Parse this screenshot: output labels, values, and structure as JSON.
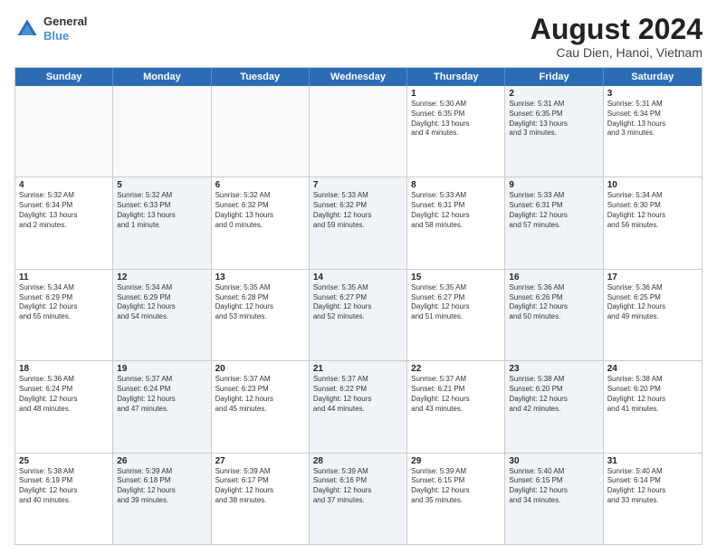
{
  "header": {
    "logo_general": "General",
    "logo_blue": "Blue",
    "title": "August 2024",
    "subtitle": "Cau Dien, Hanoi, Vietnam"
  },
  "weekdays": [
    "Sunday",
    "Monday",
    "Tuesday",
    "Wednesday",
    "Thursday",
    "Friday",
    "Saturday"
  ],
  "weeks": [
    [
      {
        "day": "",
        "info": "",
        "shaded": false,
        "empty": true
      },
      {
        "day": "",
        "info": "",
        "shaded": false,
        "empty": true
      },
      {
        "day": "",
        "info": "",
        "shaded": false,
        "empty": true
      },
      {
        "day": "",
        "info": "",
        "shaded": false,
        "empty": true
      },
      {
        "day": "1",
        "info": "Sunrise: 5:30 AM\nSunset: 6:35 PM\nDaylight: 13 hours\nand 4 minutes.",
        "shaded": false,
        "empty": false
      },
      {
        "day": "2",
        "info": "Sunrise: 5:31 AM\nSunset: 6:35 PM\nDaylight: 13 hours\nand 3 minutes.",
        "shaded": true,
        "empty": false
      },
      {
        "day": "3",
        "info": "Sunrise: 5:31 AM\nSunset: 6:34 PM\nDaylight: 13 hours\nand 3 minutes.",
        "shaded": false,
        "empty": false
      }
    ],
    [
      {
        "day": "4",
        "info": "Sunrise: 5:32 AM\nSunset: 6:34 PM\nDaylight: 13 hours\nand 2 minutes.",
        "shaded": false,
        "empty": false
      },
      {
        "day": "5",
        "info": "Sunrise: 5:32 AM\nSunset: 6:33 PM\nDaylight: 13 hours\nand 1 minute.",
        "shaded": true,
        "empty": false
      },
      {
        "day": "6",
        "info": "Sunrise: 5:32 AM\nSunset: 6:32 PM\nDaylight: 13 hours\nand 0 minutes.",
        "shaded": false,
        "empty": false
      },
      {
        "day": "7",
        "info": "Sunrise: 5:33 AM\nSunset: 6:32 PM\nDaylight: 12 hours\nand 59 minutes.",
        "shaded": true,
        "empty": false
      },
      {
        "day": "8",
        "info": "Sunrise: 5:33 AM\nSunset: 6:31 PM\nDaylight: 12 hours\nand 58 minutes.",
        "shaded": false,
        "empty": false
      },
      {
        "day": "9",
        "info": "Sunrise: 5:33 AM\nSunset: 6:31 PM\nDaylight: 12 hours\nand 57 minutes.",
        "shaded": true,
        "empty": false
      },
      {
        "day": "10",
        "info": "Sunrise: 5:34 AM\nSunset: 6:30 PM\nDaylight: 12 hours\nand 56 minutes.",
        "shaded": false,
        "empty": false
      }
    ],
    [
      {
        "day": "11",
        "info": "Sunrise: 5:34 AM\nSunset: 6:29 PM\nDaylight: 12 hours\nand 55 minutes.",
        "shaded": false,
        "empty": false
      },
      {
        "day": "12",
        "info": "Sunrise: 5:34 AM\nSunset: 6:29 PM\nDaylight: 12 hours\nand 54 minutes.",
        "shaded": true,
        "empty": false
      },
      {
        "day": "13",
        "info": "Sunrise: 5:35 AM\nSunset: 6:28 PM\nDaylight: 12 hours\nand 53 minutes.",
        "shaded": false,
        "empty": false
      },
      {
        "day": "14",
        "info": "Sunrise: 5:35 AM\nSunset: 6:27 PM\nDaylight: 12 hours\nand 52 minutes.",
        "shaded": true,
        "empty": false
      },
      {
        "day": "15",
        "info": "Sunrise: 5:35 AM\nSunset: 6:27 PM\nDaylight: 12 hours\nand 51 minutes.",
        "shaded": false,
        "empty": false
      },
      {
        "day": "16",
        "info": "Sunrise: 5:36 AM\nSunset: 6:26 PM\nDaylight: 12 hours\nand 50 minutes.",
        "shaded": true,
        "empty": false
      },
      {
        "day": "17",
        "info": "Sunrise: 5:36 AM\nSunset: 6:25 PM\nDaylight: 12 hours\nand 49 minutes.",
        "shaded": false,
        "empty": false
      }
    ],
    [
      {
        "day": "18",
        "info": "Sunrise: 5:36 AM\nSunset: 6:24 PM\nDaylight: 12 hours\nand 48 minutes.",
        "shaded": false,
        "empty": false
      },
      {
        "day": "19",
        "info": "Sunrise: 5:37 AM\nSunset: 6:24 PM\nDaylight: 12 hours\nand 47 minutes.",
        "shaded": true,
        "empty": false
      },
      {
        "day": "20",
        "info": "Sunrise: 5:37 AM\nSunset: 6:23 PM\nDaylight: 12 hours\nand 45 minutes.",
        "shaded": false,
        "empty": false
      },
      {
        "day": "21",
        "info": "Sunrise: 5:37 AM\nSunset: 6:22 PM\nDaylight: 12 hours\nand 44 minutes.",
        "shaded": true,
        "empty": false
      },
      {
        "day": "22",
        "info": "Sunrise: 5:37 AM\nSunset: 6:21 PM\nDaylight: 12 hours\nand 43 minutes.",
        "shaded": false,
        "empty": false
      },
      {
        "day": "23",
        "info": "Sunrise: 5:38 AM\nSunset: 6:20 PM\nDaylight: 12 hours\nand 42 minutes.",
        "shaded": true,
        "empty": false
      },
      {
        "day": "24",
        "info": "Sunrise: 5:38 AM\nSunset: 6:20 PM\nDaylight: 12 hours\nand 41 minutes.",
        "shaded": false,
        "empty": false
      }
    ],
    [
      {
        "day": "25",
        "info": "Sunrise: 5:38 AM\nSunset: 6:19 PM\nDaylight: 12 hours\nand 40 minutes.",
        "shaded": false,
        "empty": false
      },
      {
        "day": "26",
        "info": "Sunrise: 5:39 AM\nSunset: 6:18 PM\nDaylight: 12 hours\nand 39 minutes.",
        "shaded": true,
        "empty": false
      },
      {
        "day": "27",
        "info": "Sunrise: 5:39 AM\nSunset: 6:17 PM\nDaylight: 12 hours\nand 38 minutes.",
        "shaded": false,
        "empty": false
      },
      {
        "day": "28",
        "info": "Sunrise: 5:39 AM\nSunset: 6:16 PM\nDaylight: 12 hours\nand 37 minutes.",
        "shaded": true,
        "empty": false
      },
      {
        "day": "29",
        "info": "Sunrise: 5:39 AM\nSunset: 6:15 PM\nDaylight: 12 hours\nand 35 minutes.",
        "shaded": false,
        "empty": false
      },
      {
        "day": "30",
        "info": "Sunrise: 5:40 AM\nSunset: 6:15 PM\nDaylight: 12 hours\nand 34 minutes.",
        "shaded": true,
        "empty": false
      },
      {
        "day": "31",
        "info": "Sunrise: 5:40 AM\nSunset: 6:14 PM\nDaylight: 12 hours\nand 33 minutes.",
        "shaded": false,
        "empty": false
      }
    ]
  ]
}
